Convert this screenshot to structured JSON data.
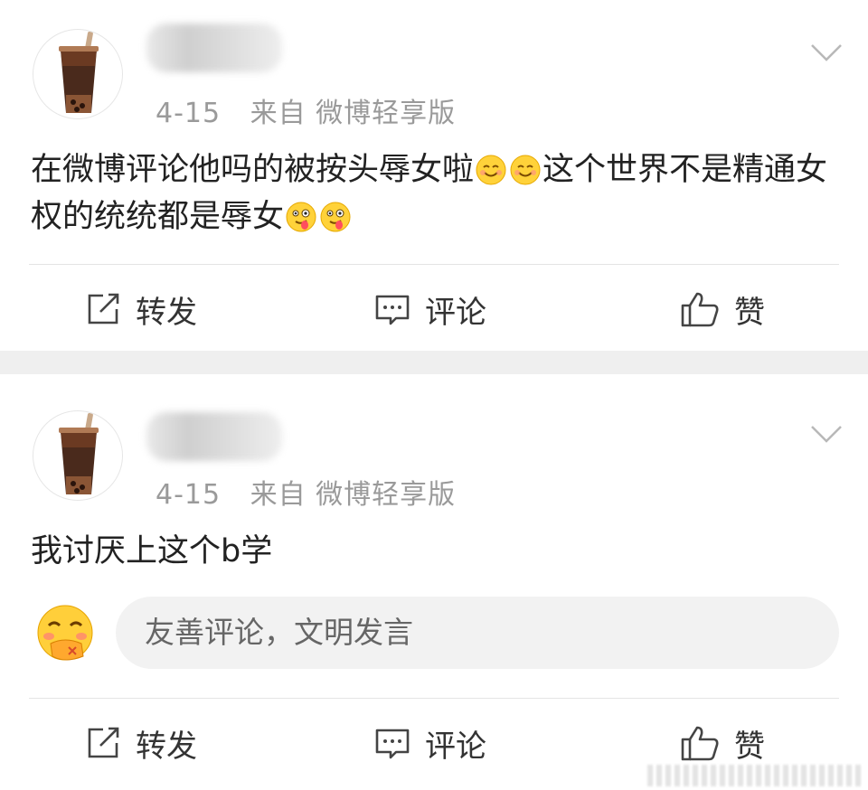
{
  "posts": [
    {
      "meta": {
        "date": "4-15",
        "source": "来自 微博轻享版"
      },
      "content_text_1": "在微博评论他吗的被按头辱女啦",
      "content_text_2": "这个世界不是精通女权的统统都是辱女",
      "emojis": [
        "smile-emoji",
        "smile-emoji",
        "tongue-emoji",
        "tongue-emoji"
      ],
      "actions": {
        "repost": "转发",
        "comment": "评论",
        "like": "赞"
      }
    },
    {
      "meta": {
        "date": "4-15",
        "source": "来自 微博轻享版"
      },
      "content_text": "我讨厌上这个b学",
      "comment_input_placeholder": "友善评论，文明发言",
      "actions": {
        "repost": "转发",
        "comment": "评论",
        "like": "赞"
      }
    }
  ],
  "colors": {
    "meta_gray": "#9a9a9a",
    "separator": "#efefef",
    "input_bg": "#f2f2f2"
  }
}
